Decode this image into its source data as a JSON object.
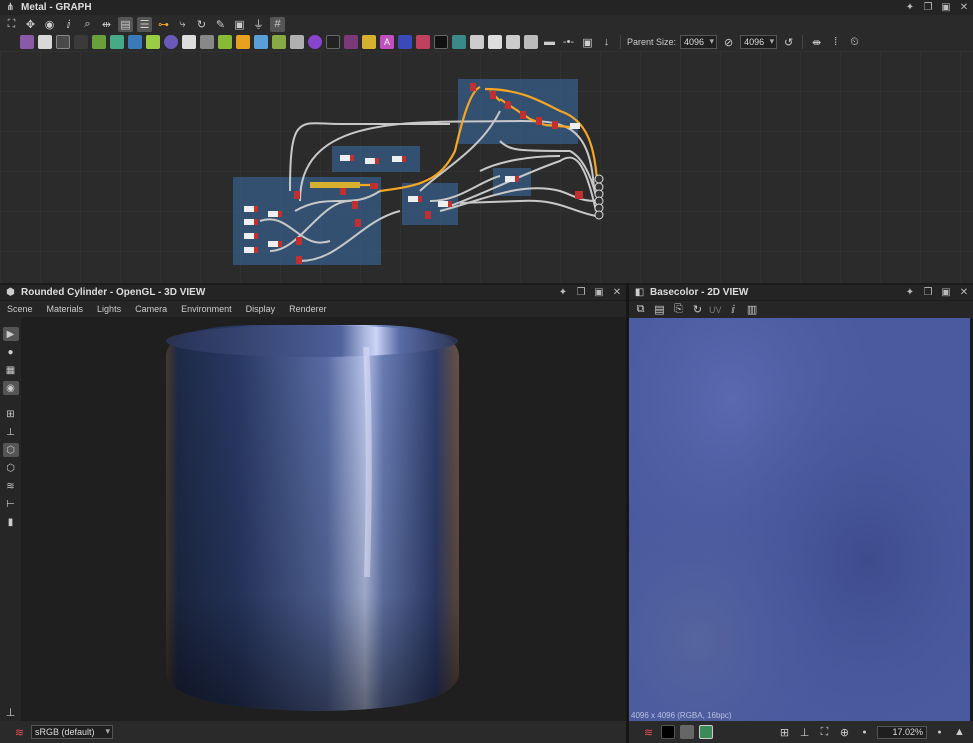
{
  "graph_panel": {
    "title": "Metal - GRAPH",
    "parent_size_label": "Parent Size:",
    "parent_size_w": "4096",
    "parent_size_h": "4096"
  },
  "view3d_panel": {
    "title": "Rounded Cylinder - OpenGL - 3D VIEW",
    "menu": [
      "Scene",
      "Materials",
      "Lights",
      "Camera",
      "Environment",
      "Display",
      "Renderer"
    ],
    "colorspace": "sRGB (default)"
  },
  "view2d_panel": {
    "title": "Basecolor - 2D VIEW",
    "uv_label": "UV",
    "texture_info": "4096 x 4096 (RGBA, 16bpc)",
    "zoom": "17.02%"
  },
  "colors": {
    "accent_orange": "#f5a623",
    "link_gray": "#c8c8c8",
    "frame_blue": "#386496",
    "texture_blue": "#4a5a9e"
  }
}
